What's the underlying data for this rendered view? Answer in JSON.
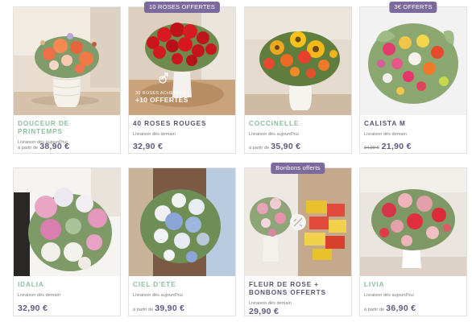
{
  "products": [
    {
      "name": "DOUCEUR DE PRINTEMPS",
      "name_style": "green",
      "badge": "",
      "delivery": "Livraison dès aujourd'hui",
      "from": "à partir de",
      "old_price": "",
      "price": "38,90 €",
      "overlay_line1": "",
      "overlay_line2": ""
    },
    {
      "name": "40 ROSES ROUGES",
      "name_style": "dark",
      "badge": "10 ROSES OFFERTES",
      "delivery": "Livraison dès demain",
      "from": "",
      "old_price": "",
      "price": "32,90 €",
      "overlay_line1": "30 roses achetées",
      "overlay_line2": "+10 OFFERTES"
    },
    {
      "name": "COCCINELLE",
      "name_style": "green",
      "badge": "",
      "delivery": "Livraison dès aujourd'hui",
      "from": "à partir de",
      "old_price": "",
      "price": "35,90 €",
      "overlay_line1": "",
      "overlay_line2": ""
    },
    {
      "name": "CALISTA M",
      "name_style": "dark",
      "badge": "3€ OFFERTS",
      "delivery": "Livraison dès demain",
      "from": "",
      "old_price": "24,90 €",
      "price": "21,90 €",
      "overlay_line1": "",
      "overlay_line2": ""
    },
    {
      "name": "IDALIA",
      "name_style": "green",
      "badge": "",
      "delivery": "Livraison dès demain",
      "from": "",
      "old_price": "",
      "price": "32,90 €",
      "overlay_line1": "",
      "overlay_line2": ""
    },
    {
      "name": "CIEL D'ETE",
      "name_style": "green",
      "badge": "",
      "delivery": "Livraison dès aujourd'hui",
      "from": "à partir de",
      "old_price": "",
      "price": "39,90 €",
      "overlay_line1": "",
      "overlay_line2": ""
    },
    {
      "name": "FLEUR DE ROSE + BONBONS OFFERTS",
      "name_style": "dark",
      "badge": "Bonbons offerts",
      "delivery": "Livraison dès demain",
      "from": "",
      "old_price": "",
      "price": "29,90 €",
      "overlay_line1": "",
      "overlay_line2": ""
    },
    {
      "name": "LIVIA",
      "name_style": "green",
      "badge": "",
      "delivery": "Livraison dès aujourd'hui",
      "from": "à partir de",
      "old_price": "",
      "price": "36,90 €",
      "overlay_line1": "",
      "overlay_line2": ""
    }
  ],
  "colors": {
    "name_green": "#8bbf9e",
    "name_dark": "#585470",
    "price": "#605a7e",
    "badge": "#7c6a9c"
  }
}
